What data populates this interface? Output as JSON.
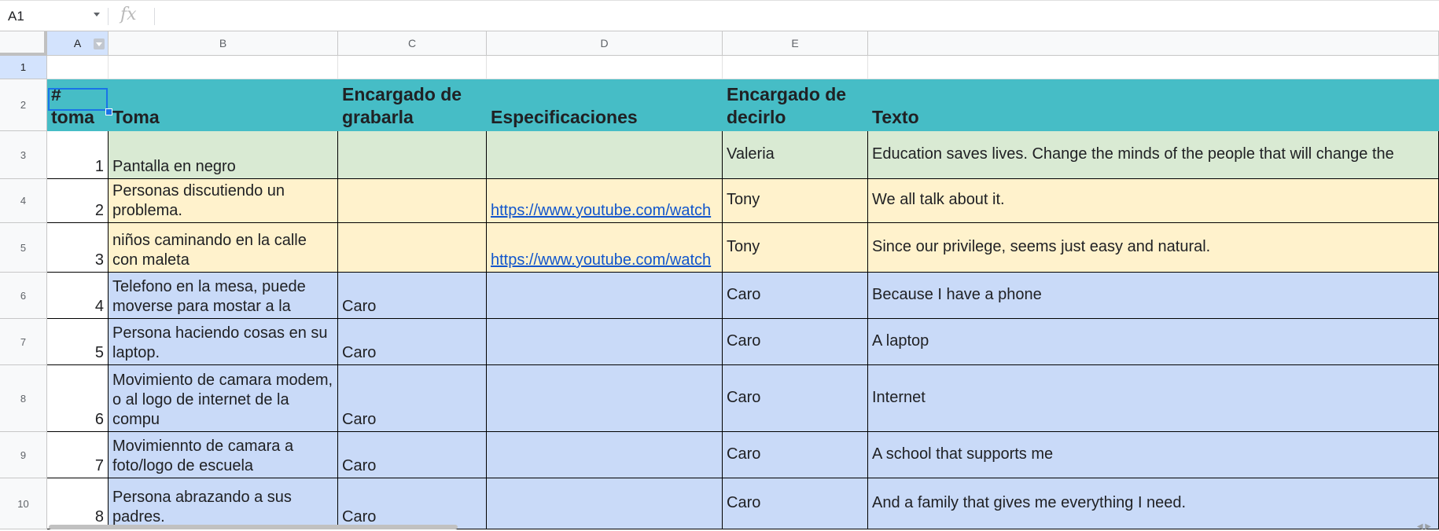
{
  "formula_bar": {
    "name_box": "A1",
    "fx_label": "fx",
    "formula": ""
  },
  "columns": [
    "A",
    "B",
    "C",
    "D",
    "E"
  ],
  "rows": [
    "1",
    "2",
    "3",
    "4",
    "5",
    "6",
    "7",
    "8",
    "9",
    "10"
  ],
  "header_row": [
    "#\ntoma",
    "Toma",
    "Encargado de\ngrabarla",
    "Especificaciones",
    "Encargado de\ndecirlo",
    "Texto"
  ],
  "data_rows": [
    {
      "num": "1",
      "toma": "Pantalla en negro",
      "grabar": "",
      "spec": "",
      "decir": "Valeria",
      "texto": "Education saves lives. Change the minds of the people that will change the"
    },
    {
      "num": "2",
      "toma": "Personas discutiendo un problema.",
      "grabar": "",
      "spec": "https://www.youtube.com/watch",
      "decir": "Tony",
      "texto": "We all talk about it."
    },
    {
      "num": "3",
      "toma": "niños caminando en la calle con maleta",
      "grabar": "",
      "spec": "https://www.youtube.com/watch",
      "decir": "Tony",
      "texto": "Since our privilege, seems just easy and natural."
    },
    {
      "num": "4",
      "toma": "Telefono en la mesa, puede moverse para mostar a la",
      "grabar": "Caro",
      "spec": "",
      "decir": "Caro",
      "texto": "Because I have a phone"
    },
    {
      "num": "5",
      "toma": "Persona haciendo cosas en su laptop.",
      "grabar": "Caro",
      "spec": "",
      "decir": "Caro",
      "texto": "A laptop"
    },
    {
      "num": "6",
      "toma": "Movimiento de camara modem, o al logo de internet de la compu",
      "grabar": "Caro",
      "spec": "",
      "decir": "Caro",
      "texto": "Internet"
    },
    {
      "num": "7",
      "toma": "Movimiennto de camara a foto/logo de escuela",
      "grabar": "Caro",
      "spec": "",
      "decir": "Caro",
      "texto": "A school that supports me"
    },
    {
      "num": "8",
      "toma": "Persona abrazando a sus padres.",
      "grabar": "Caro",
      "spec": "",
      "decir": "Caro",
      "texto": "And a family that gives me everything I need."
    }
  ],
  "colors": {
    "header": "#46bdc6",
    "green": "#d9ead3",
    "yellow": "#fff2cc",
    "blue": "#c9daf8",
    "selection": "#1a73e8",
    "link": "#1155cc"
  }
}
